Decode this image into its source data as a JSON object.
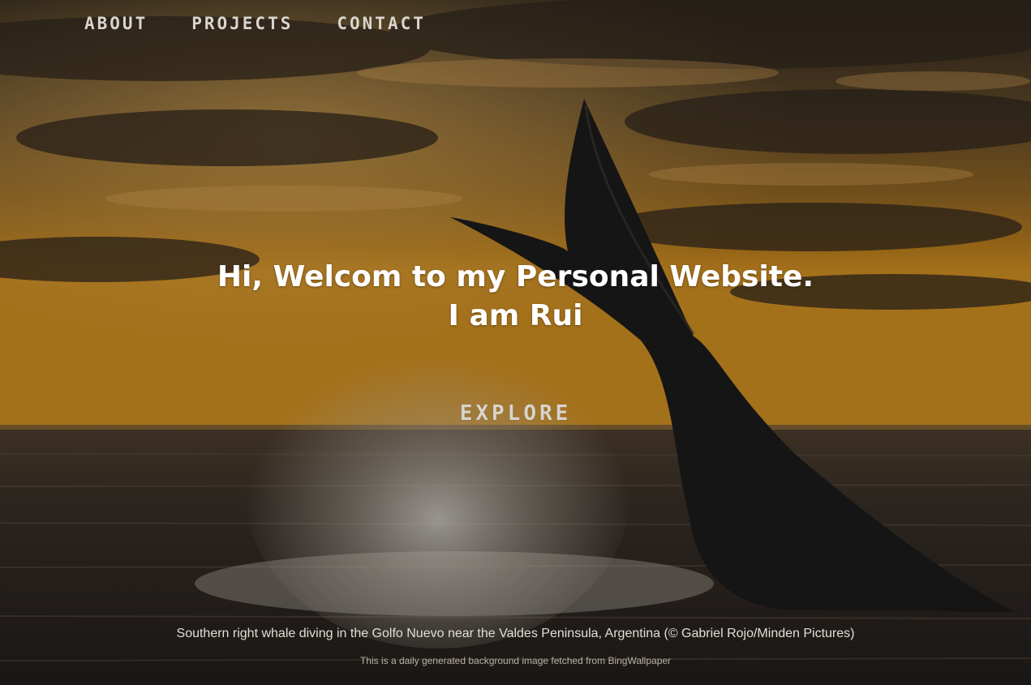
{
  "nav": {
    "items": [
      {
        "label": "ABOUT"
      },
      {
        "label": "PROJECTS"
      },
      {
        "label": "CONTACT"
      }
    ]
  },
  "hero": {
    "line1": "Hi, Welcom to my Personal Website.",
    "line2": "I am Rui",
    "explore_label": "EXPLORE"
  },
  "background": {
    "caption": "Southern right whale diving in the Golfo Nuevo near the Valdes Peninsula, Argentina (© Gabriel Rojo/Minden Pictures)",
    "note": "This is a daily generated background image fetched from BingWallpaper"
  },
  "colors": {
    "sky_top": "#3a2e22",
    "sky_glow": "#c98a1e",
    "sea": "#2a2622",
    "whale": "#1c1a1a",
    "nav_text": "#d9d6cf",
    "hero_text": "#ffffff"
  }
}
